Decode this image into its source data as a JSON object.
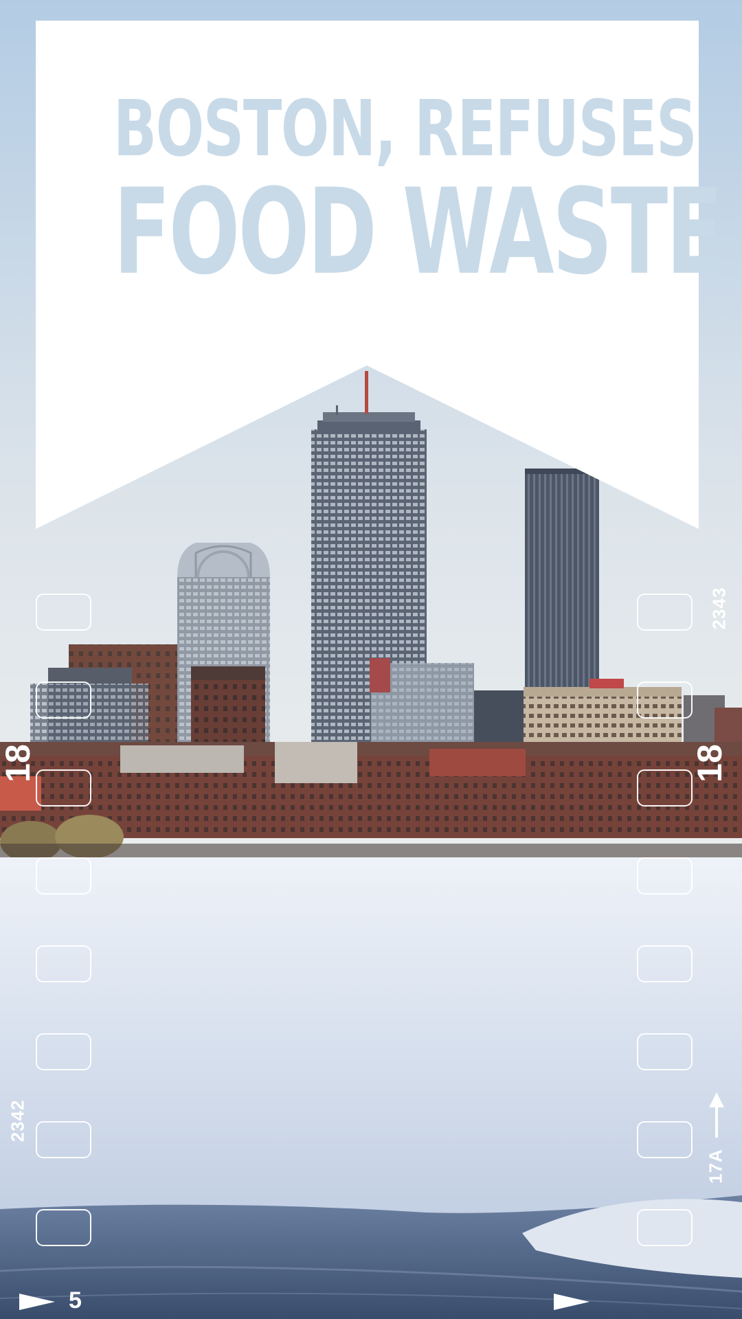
{
  "headline": {
    "line1": "BOSTON, REFUSES",
    "line2": "FOOD WASTE"
  },
  "film_edge": {
    "left_rotated_big": "18",
    "left_rotated_small": "2342",
    "right_rotated_big": "18",
    "right_rotated_small_top": "2343",
    "right_rotated_small_bottom": "17A",
    "bottom_left_number": "5"
  },
  "colors": {
    "sky_top": "#b3cce4",
    "sky_bottom": "#e7ebee",
    "banner": "#ffffff",
    "headline_text": "#c8dae8",
    "ice": "#dbe3ef",
    "water": "#4a5f80"
  },
  "icons": {
    "arrow_up": "arrow-up-icon",
    "play_markers": "triangle-marker-icon"
  }
}
